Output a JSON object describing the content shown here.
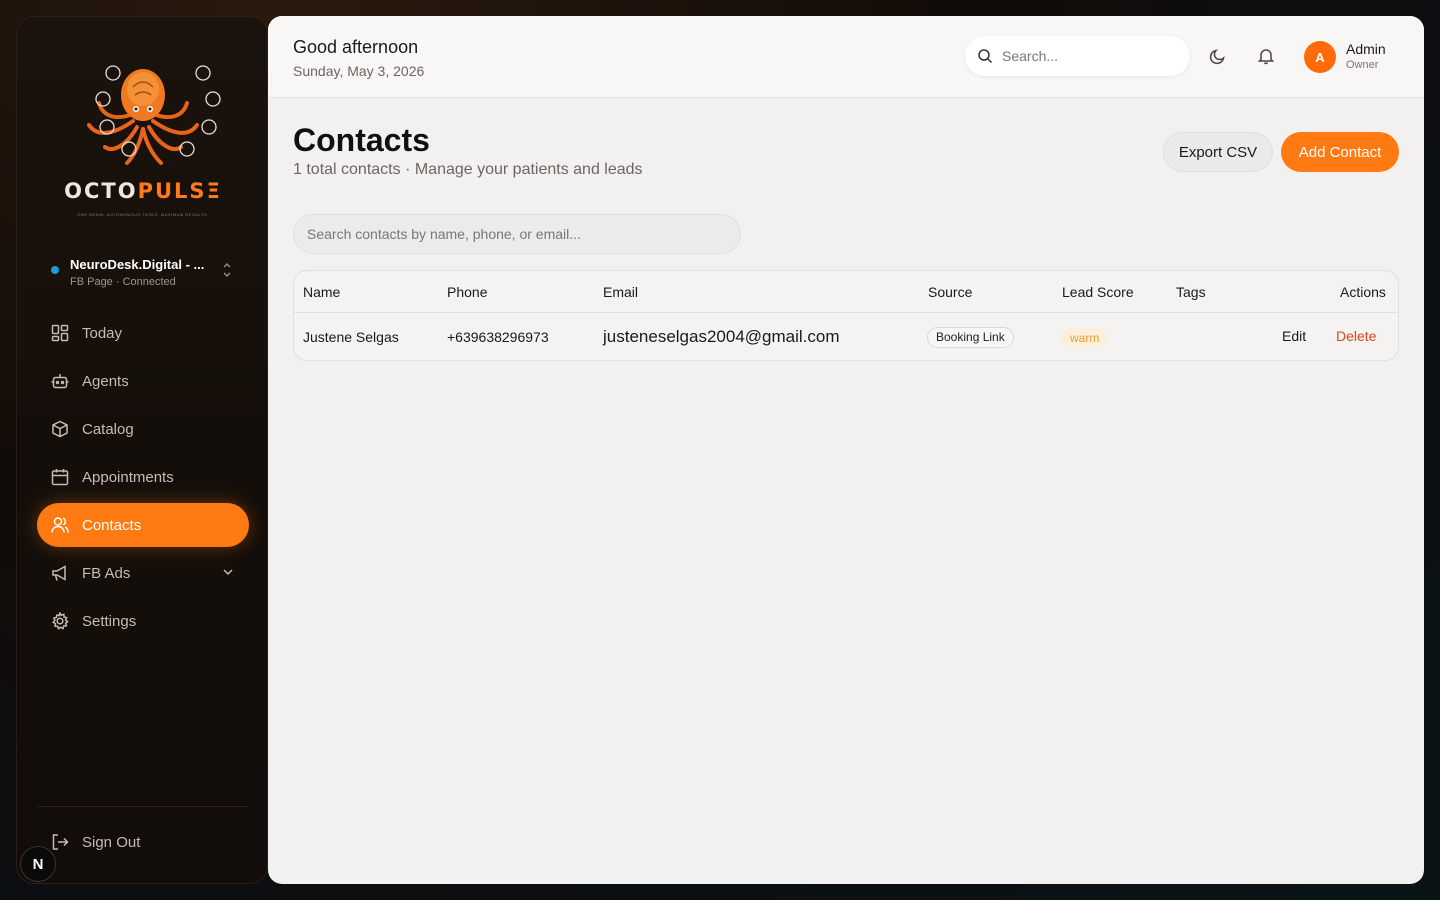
{
  "sidebar": {
    "logo": {
      "word_a": "OCTO",
      "word_b": "PULS",
      "word_c": "Ξ",
      "tagline": "ONE BRAIN. AUTONOMOUS TASKS. MAXIMUM RESULTS."
    },
    "workspace": {
      "name": "NeuroDesk.Digital - ...",
      "status": "FB Page · Connected"
    },
    "items": [
      {
        "label": "Today",
        "icon": "dashboard-icon"
      },
      {
        "label": "Agents",
        "icon": "robot-icon"
      },
      {
        "label": "Catalog",
        "icon": "box-icon"
      },
      {
        "label": "Appointments",
        "icon": "calendar-icon"
      },
      {
        "label": "Contacts",
        "icon": "users-icon",
        "active": true
      },
      {
        "label": "FB Ads",
        "icon": "megaphone-icon"
      },
      {
        "label": "Settings",
        "icon": "gear-icon"
      }
    ],
    "signout": "Sign Out",
    "badge": "N"
  },
  "header": {
    "greeting": "Good afternoon",
    "date": "Sunday, May 3, 2026",
    "search_placeholder": "Search...",
    "user": {
      "initial": "A",
      "name": "Admin",
      "role": "Owner"
    }
  },
  "page": {
    "title": "Contacts",
    "subtitle": "1 total contacts · Manage your patients and leads",
    "export_label": "Export CSV",
    "add_label": "Add Contact",
    "search_placeholder": "Search contacts by name, phone, or email..."
  },
  "table": {
    "columns": [
      "Name",
      "Phone",
      "Email",
      "Source",
      "Lead Score",
      "Tags",
      "Actions"
    ],
    "rows": [
      {
        "name": "Justene Selgas",
        "phone": "+639638296973",
        "email": "justeneselgas2004@gmail.com",
        "source": "Booking Link",
        "lead_score": "warm",
        "tags": "",
        "edit": "Edit",
        "delete": "Delete"
      }
    ]
  },
  "colors": {
    "accent": "#ff7a12",
    "danger": "#e0461a",
    "warm": "#e8a030",
    "connected": "#1e9bd6"
  }
}
